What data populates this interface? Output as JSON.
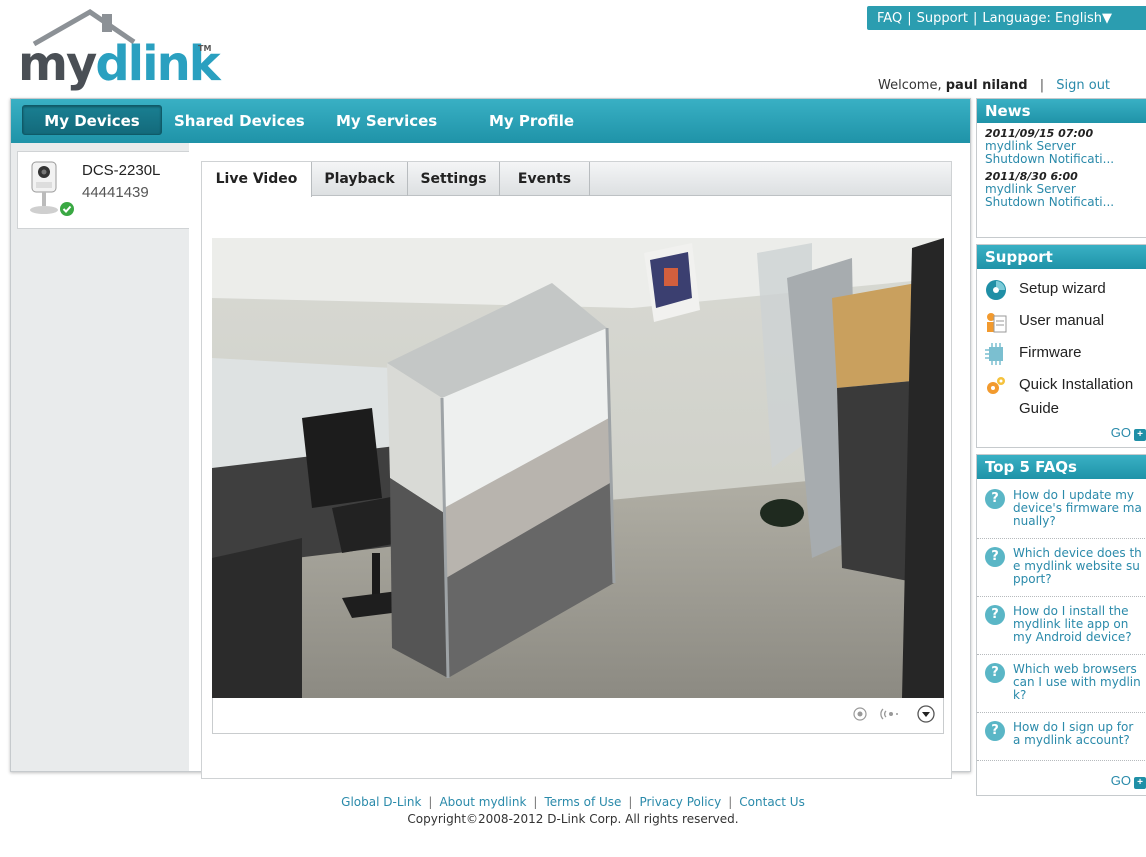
{
  "top_links": {
    "faq": "FAQ",
    "support": "Support",
    "language": "Language: English▼"
  },
  "logo": {
    "my": "my",
    "dlink": "dlink",
    "tm": "TM"
  },
  "welcome": {
    "prefix": "Welcome,",
    "user": "paul niland",
    "signout": "Sign out"
  },
  "nav": {
    "my_devices": "My Devices",
    "shared_devices": "Shared Devices",
    "my_services": "My Services",
    "my_profile": "My Profile"
  },
  "device": {
    "name": "DCS-2230L",
    "id": "44441439"
  },
  "tabs": {
    "live": "Live Video",
    "playback": "Playback",
    "settings": "Settings",
    "events": "Events"
  },
  "news": {
    "title": "News",
    "items": [
      {
        "date": "2011/09/15 07:00",
        "line1": "mydlink Server",
        "line2": "Shutdown Notificati..."
      },
      {
        "date": "2011/8/30 6:00",
        "line1": "mydlink Server",
        "line2": "Shutdown Notificati..."
      }
    ]
  },
  "support": {
    "title": "Support",
    "items": [
      "Setup wizard",
      "User manual",
      "Firmware",
      "Quick Installation",
      "Guide"
    ],
    "go": "GO"
  },
  "faqs": {
    "title": "Top 5 FAQs",
    "items": [
      [
        "How do I update my",
        "device's firmware ma",
        "nually?"
      ],
      [
        "Which device does th",
        "e mydlink website su",
        "pport?"
      ],
      [
        "How do I install the",
        "mydlink lite app on",
        "my Android device?"
      ],
      [
        "Which web browsers",
        "can I use with mydlin",
        "k?"
      ],
      [
        "How do I sign up for",
        "a mydlink account?"
      ]
    ],
    "go": "GO"
  },
  "footer": {
    "links": [
      "Global D-Link",
      "About mydlink",
      "Terms of Use",
      "Privacy Policy",
      "Contact Us"
    ],
    "copyright": "Copyright©2008-2012 D-Link Corp. All rights reserved."
  },
  "colors": {
    "accent": "#2b9db0",
    "nav_active": "#136a7b",
    "link": "#2a8aaa"
  }
}
